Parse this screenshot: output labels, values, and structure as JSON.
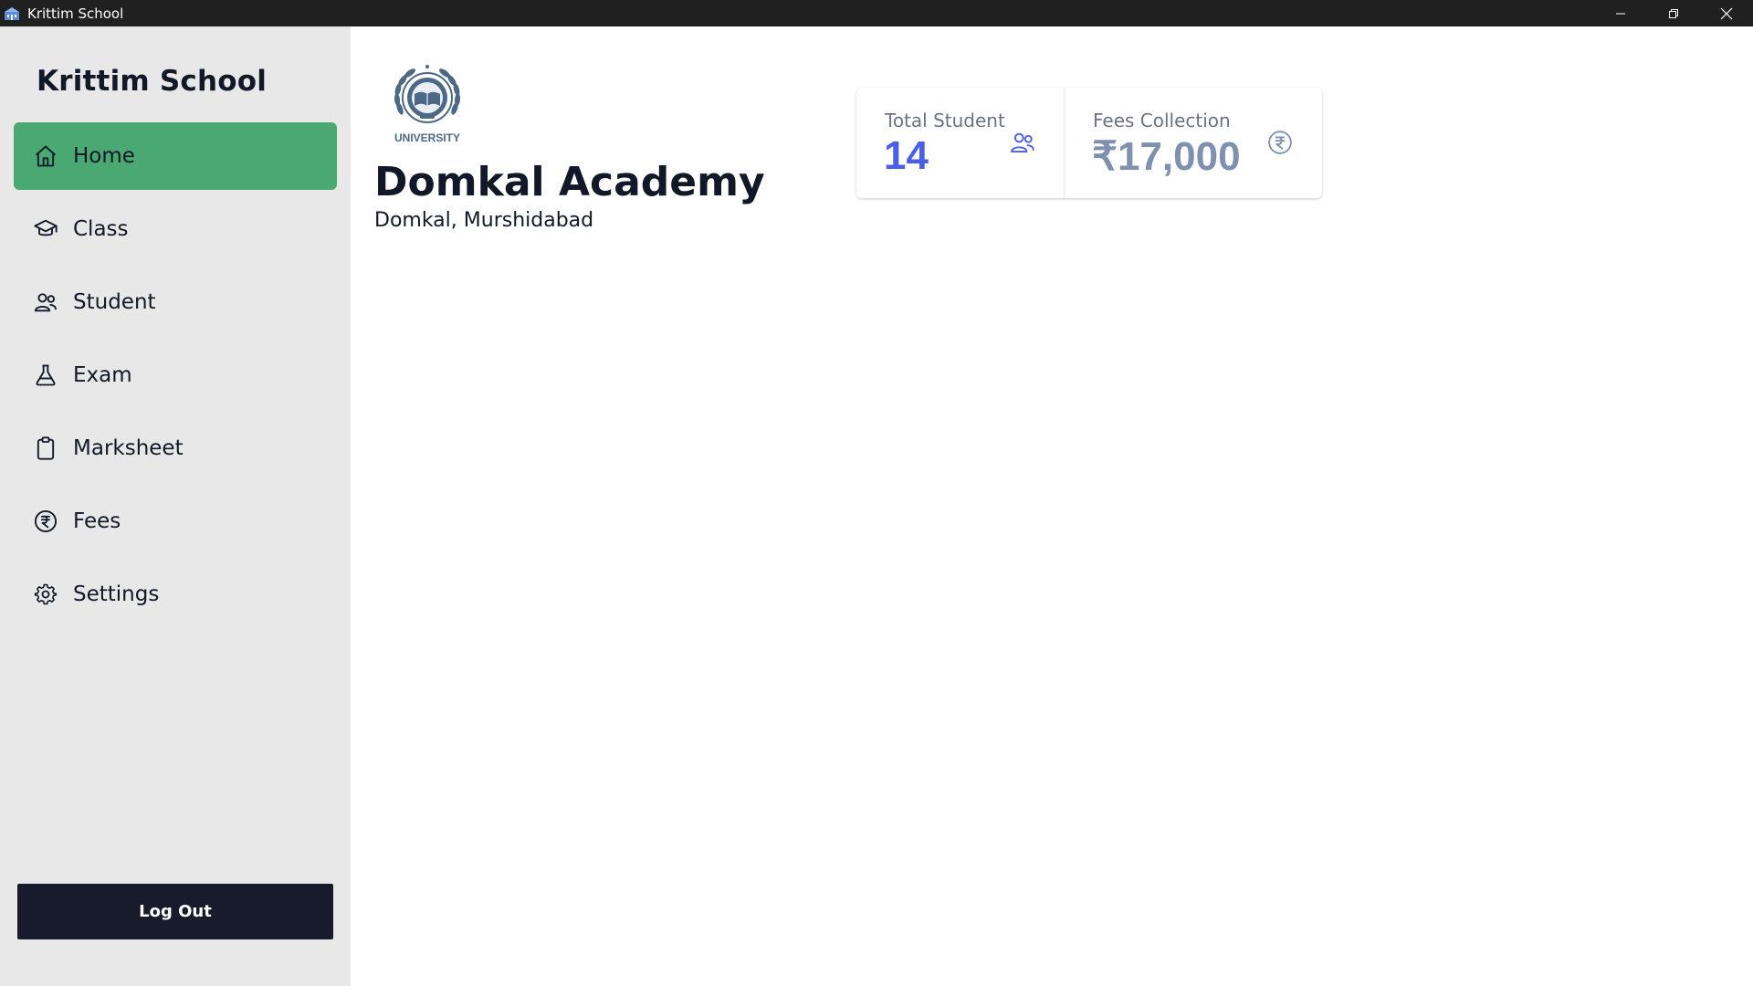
{
  "window": {
    "title": "Krittim School",
    "icons": {
      "app": "school-building-icon",
      "minimize": "minimize-icon",
      "restore": "restore-icon",
      "close": "close-icon"
    }
  },
  "sidebar": {
    "brand": "Krittim School",
    "items": [
      {
        "label": "Home",
        "icon": "home-icon",
        "active": true
      },
      {
        "label": "Class",
        "icon": "graduation-cap-icon",
        "active": false
      },
      {
        "label": "Student",
        "icon": "users-icon",
        "active": false
      },
      {
        "label": "Exam",
        "icon": "flask-icon",
        "active": false
      },
      {
        "label": "Marksheet",
        "icon": "clipboard-icon",
        "active": false
      },
      {
        "label": "Fees",
        "icon": "rupee-circle-icon",
        "active": false
      },
      {
        "label": "Settings",
        "icon": "gear-icon",
        "active": false
      }
    ],
    "logout_label": "Log Out"
  },
  "main": {
    "logo_text": "UNIVERSITY",
    "school_name": "Domkal Academy",
    "school_address": "Domkal, Murshidabad",
    "stats": [
      {
        "title": "Total Student",
        "value": "14",
        "icon": "users-icon"
      },
      {
        "title": "Fees Collection",
        "value": "₹17,000",
        "icon": "rupee-circle-icon"
      }
    ]
  },
  "colors": {
    "sidebar_bg": "#e8e8e8",
    "active_item": "#4aa872",
    "logout_bg": "#181b2b",
    "student_value": "#4a5ee8",
    "fees_value": "#8090b0",
    "titlebar_bg": "#202020"
  }
}
